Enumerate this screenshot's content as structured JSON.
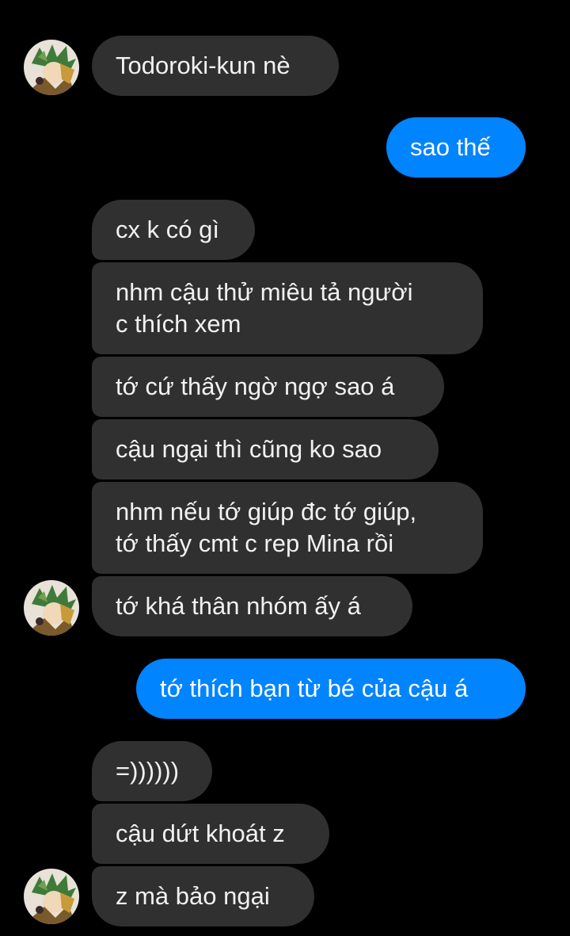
{
  "conversation": {
    "messages": [
      {
        "side": "in",
        "text": "Todoroki-kun nè"
      },
      {
        "side": "out",
        "text": "sao thế"
      },
      {
        "side": "in",
        "text": "cx k có gì"
      },
      {
        "side": "in",
        "lines": [
          "nhm cậu thử miêu tả người",
          "c thích xem"
        ]
      },
      {
        "side": "in",
        "text": "tớ cứ thấy ngờ ngợ sao á"
      },
      {
        "side": "in",
        "text": "cậu ngại thì cũng ko sao"
      },
      {
        "side": "in",
        "lines": [
          "nhm nếu tớ giúp đc tớ giúp,",
          "tớ thấy cmt c rep Mina rồi"
        ]
      },
      {
        "side": "in",
        "text": "tớ khá thân nhóm ấy á"
      },
      {
        "side": "out",
        "text": "tớ thích bạn từ bé của cậu á"
      },
      {
        "side": "in",
        "text": "=))))))"
      },
      {
        "side": "in",
        "text": "cậu dứt khoát z"
      },
      {
        "side": "in",
        "text": "z mà bảo ngại"
      }
    ]
  },
  "colors": {
    "background": "#000000",
    "incoming_bubble": "#303030",
    "outgoing_bubble": "#0084ff",
    "text": "#f1f1f1"
  },
  "icons": {
    "avatar": "contact-avatar-icon"
  }
}
